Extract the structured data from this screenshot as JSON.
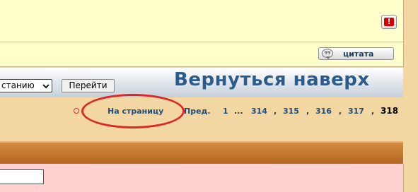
{
  "post": {
    "report_glyph": "!",
    "report_icon": "exclamation-icon",
    "quote_label": "цитата",
    "quote_icon": "speech-bubble-icon"
  },
  "jump": {
    "select_value": "станию",
    "go_label": "Перейти"
  },
  "back_to_top": "Вернуться наверх",
  "pagination": {
    "to_page_label": "На страницу",
    "prev_label": "Пред.",
    "first": "1",
    "ellipsis": "...",
    "pages": [
      "314",
      "315",
      "316",
      "317"
    ],
    "current": "318"
  },
  "annotation": {
    "color": "#e0252a"
  }
}
